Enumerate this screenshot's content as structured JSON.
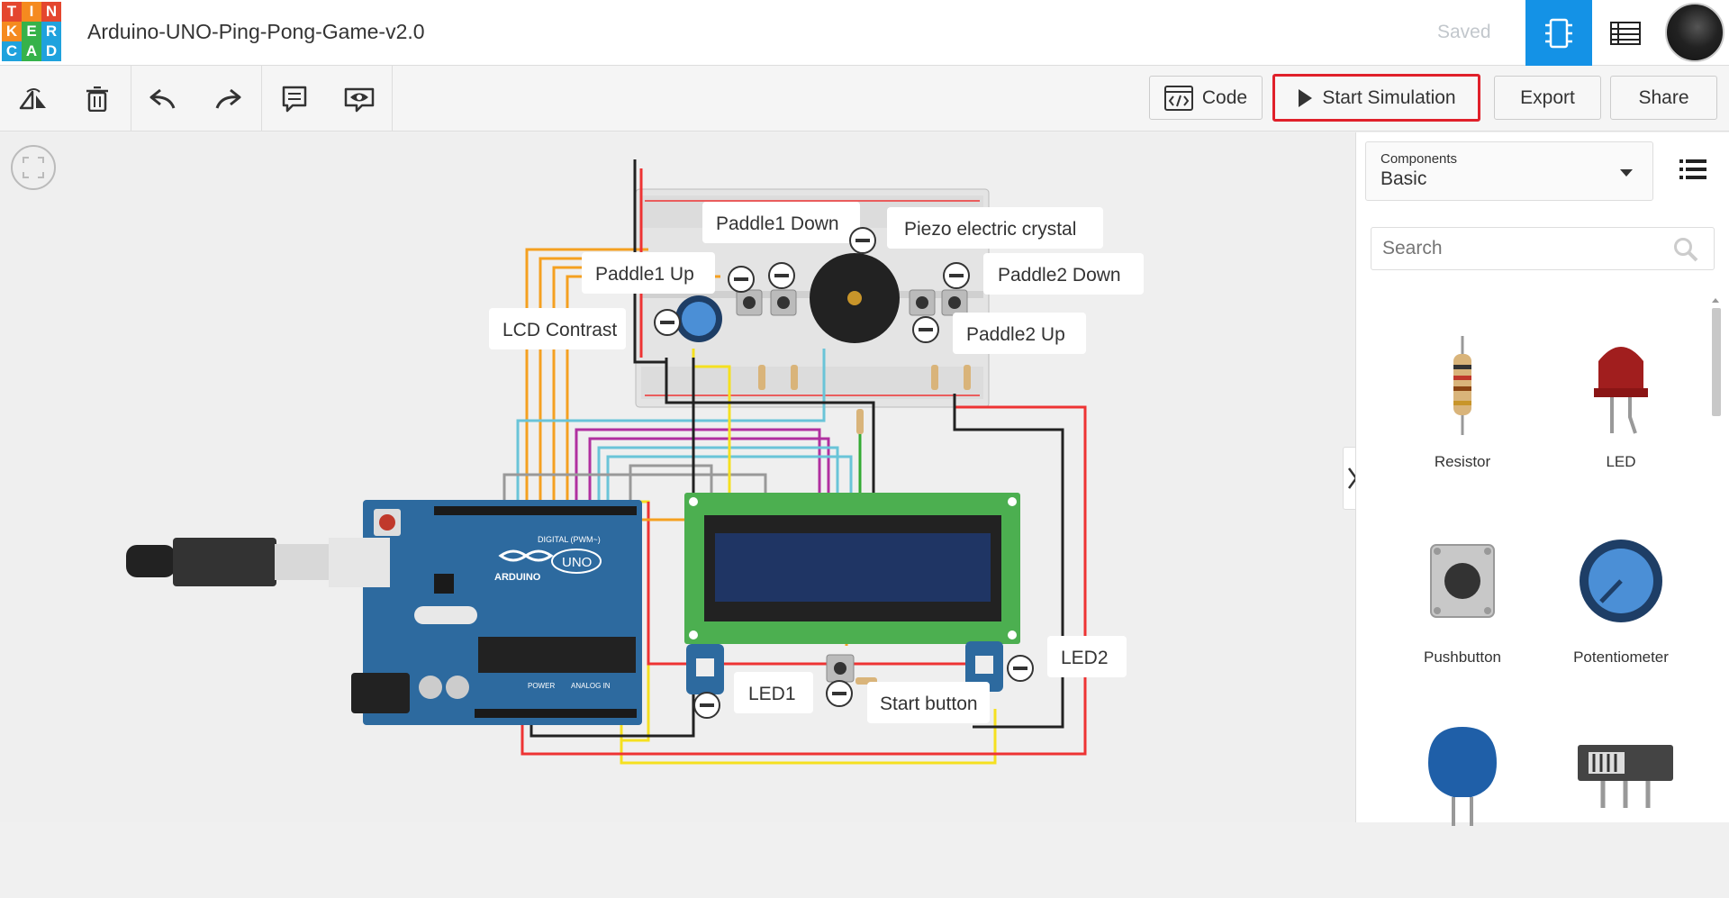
{
  "app": {
    "logo_letters": [
      "T",
      "I",
      "N",
      "K",
      "E",
      "R",
      "C",
      "A",
      "D"
    ],
    "project_title": "Arduino-UNO-Ping-Pong-Game-v2.0",
    "save_status": "Saved"
  },
  "toolbar": {
    "code_label": "Code",
    "start_label": "Start Simulation",
    "export_label": "Export",
    "share_label": "Share"
  },
  "sidebar": {
    "components_label": "Components",
    "components_value": "Basic",
    "search_placeholder": "Search",
    "components": [
      {
        "name": "Resistor"
      },
      {
        "name": "LED"
      },
      {
        "name": "Pushbutton"
      },
      {
        "name": "Potentiometer"
      }
    ]
  },
  "circuit": {
    "labels": {
      "paddle1_down": "Paddle1 Down",
      "piezo": "Piezo electric crystal",
      "paddle1_up": "Paddle1 Up",
      "paddle2_down": "Paddle2 Down",
      "lcd_contrast": "LCD Contrast",
      "paddle2_up": "Paddle2 Up",
      "led2": "LED2",
      "led1": "LED1",
      "start_button": "Start button"
    },
    "arduino": {
      "brand": "ARDUINO",
      "model": "UNO",
      "digital": "DIGITAL (PWM~)",
      "power": "POWER",
      "analog": "ANALOG IN"
    }
  },
  "colors": {
    "accent": "#1492e6",
    "start_border": "#e0202a",
    "arduino_board": "#2d6a9f",
    "lcd_board": "#4caf50"
  }
}
